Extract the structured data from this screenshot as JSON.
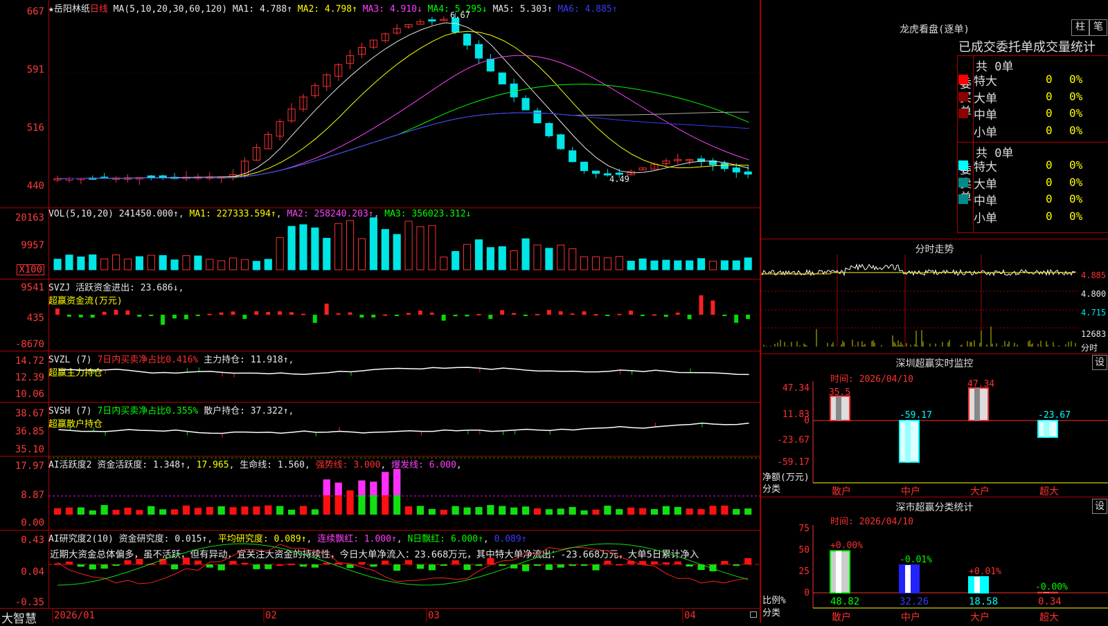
{
  "stock": {
    "name": "★岳阳林纸",
    "period": "日线",
    "ma_header": "MA(5,10,20,30,60,120)",
    "ma_values": [
      {
        "label": "MA1: 4.788↑",
        "color": "#e8e8e8"
      },
      {
        "label": "MA2: 4.798↑",
        "color": "#ffff00"
      },
      {
        "label": "MA3: 4.910↓",
        "color": "#ff40ff"
      },
      {
        "label": "MA4: 5.295↓",
        "color": "#00ff00"
      },
      {
        "label": "MA5: 5.303↑",
        "color": "#e8e8e8"
      },
      {
        "label": "MA6: 4.885↑",
        "color": "#3a3aff"
      }
    ],
    "price_high_marker": "6.67",
    "price_low_marker": "4.49"
  },
  "price_axis": [
    "667",
    "591",
    "516",
    "440"
  ],
  "volume": {
    "header": "VOL(5,10,20)",
    "value": "241450.000↑",
    "ma1": "MA1: 227333.594↑",
    "ma2": "MA2: 258240.203↑",
    "ma3": "MA3: 356023.312↓",
    "axis": [
      "20163",
      "9957",
      "X100"
    ]
  },
  "svzj": {
    "header": "SVZJ",
    "label": "活跃资金进出: 23.686↓",
    "subtitle": "超赢资金流(万元)",
    "axis": [
      "9541",
      "435",
      "-8670"
    ]
  },
  "svzl": {
    "header": "SVZL (7)",
    "ratio": "7日内买卖净占比0.416%",
    "hold": "主力持仓: 11.918↑",
    "subtitle": "超赢主力持仓",
    "axis": [
      "14.72",
      "12.39",
      "10.06"
    ]
  },
  "svsh": {
    "header": "SVSH (7)",
    "ratio": "7日内买卖净占比0.355%",
    "hold": "散户持仓: 37.322↑",
    "subtitle": "超赢散户持仓",
    "axis": [
      "38.67",
      "36.85",
      "35.10"
    ]
  },
  "ai_active": {
    "header": "AI活跃度2",
    "fund": "资金活跃度: 1.348↑",
    "v2": "17.965",
    "life": "生命线: 1.560",
    "strong": "强势线: 3.000",
    "burst": "爆发线: 6.000",
    "axis": [
      "17.97",
      "8.87",
      "0.00"
    ]
  },
  "ai_research": {
    "header": "AI研究度2(10)",
    "research": "资金研究度: 0.015↑",
    "avg": "平均研究度: 0.089↑",
    "red": "连续飘红: 1.000↑",
    "nred": "N日飘红: 6.000↑",
    "last": "0.089↑",
    "commentary": "近期大资金总体偏多，虽不活跃，但有异动，宜关注大资金的持续性，今日大单净流入：23.668万元，其中特大单净流出：-23.668万元，大单5日累计净入",
    "axis": [
      "0.43",
      "0.04",
      "-0.35"
    ]
  },
  "dates": [
    "2026/01",
    "02",
    "03",
    "04"
  ],
  "brand": "大智慧",
  "dragon": {
    "title": "龙虎看盘(逐单)",
    "btn_bar": "柱",
    "btn_pen": "笔",
    "tabs": "已成交委托单成交量统计",
    "buy_label": "委买单",
    "sell_label": "委卖单",
    "buy_total": "共 0单",
    "sell_total": "共 0单",
    "rows": [
      "特大",
      "大单",
      "中单",
      "小单"
    ],
    "count": "0",
    "pct": "0%",
    "buy_colors": [
      "#ff0000",
      "#8b0000",
      "#8b0000",
      "#000000"
    ],
    "sell_colors": [
      "#00ffff",
      "#008b8b",
      "#008b8b",
      "#000000"
    ]
  },
  "intraday": {
    "title": "分时走势",
    "axis": [
      "4.885",
      "4.800",
      "4.715",
      "12683",
      "分时"
    ]
  },
  "sz_monitor": {
    "title": "深圳超赢实时监控",
    "btn": "设",
    "time": "时间: 2026/04/10",
    "axis": [
      "47.34",
      "11.83",
      "0",
      "-23.67",
      "-59.17"
    ],
    "ylabel1": "净额(万元)",
    "ylabel2": "分类",
    "categories": [
      "散户",
      "中户",
      "大户",
      "超大"
    ],
    "values": [
      35.5,
      -59.17,
      47.34,
      -23.67
    ],
    "value_labels": [
      "35.5",
      "-59.17",
      "47.34",
      "-23.67"
    ]
  },
  "sh_stats": {
    "title": "深市超赢分类统计",
    "btn": "设",
    "time": "时间: 2026/04/10",
    "axis": [
      "75",
      "50",
      "25",
      "0"
    ],
    "ylabel1": "比例%",
    "ylabel2": "分类",
    "categories": [
      "散户",
      "中户",
      "大户",
      "超大"
    ],
    "values": [
      48.82,
      32.26,
      18.58,
      0.34
    ],
    "value_labels": [
      "48.82",
      "32.26",
      "18.58",
      "0.34"
    ],
    "change_labels": [
      "+0.00%",
      "-0.01%",
      "+0.01%",
      "-0.00%"
    ]
  },
  "chart_data": [
    {
      "type": "bar",
      "title": "深圳超赢实时监控",
      "categories": [
        "散户",
        "中户",
        "大户",
        "超大"
      ],
      "values": [
        35.5,
        -59.17,
        47.34,
        -23.67
      ],
      "ylabel": "净额(万元)",
      "xlabel": "分类",
      "ylim": [
        -59.17,
        47.34
      ]
    },
    {
      "type": "bar",
      "title": "深市超赢分类统计",
      "categories": [
        "散户",
        "中户",
        "大户",
        "超大"
      ],
      "values": [
        48.82,
        32.26,
        18.58,
        0.34
      ],
      "ylabel": "比例%",
      "xlabel": "分类",
      "ylim": [
        0,
        75
      ]
    }
  ],
  "colors": {
    "up": "#ff3030",
    "down": "#00e5e5",
    "border": "#b00000",
    "grid": "#b00000"
  }
}
